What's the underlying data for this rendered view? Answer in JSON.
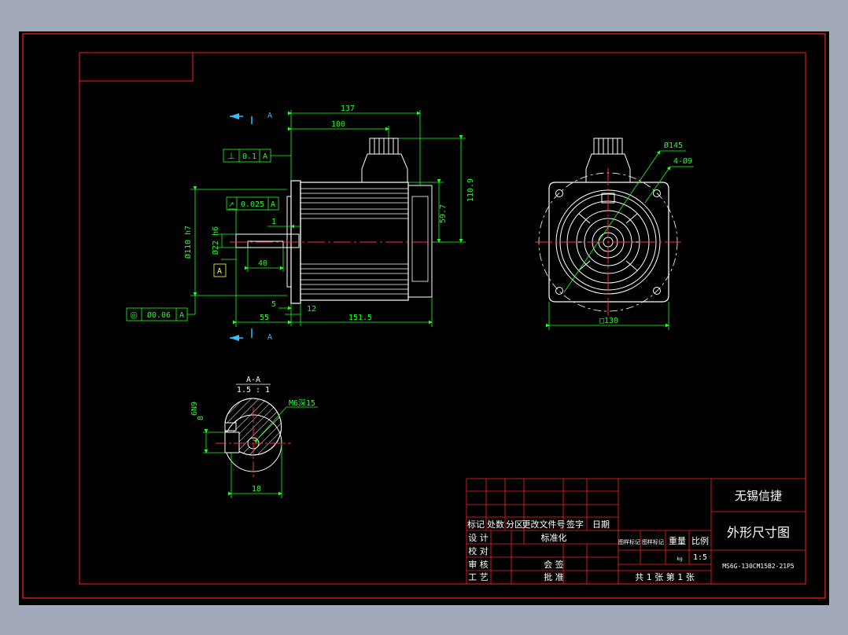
{
  "colors": {
    "background": "#a2a9b8",
    "sheet": "#000000",
    "frame": "#ff2020",
    "green": "#20ff20",
    "white": "#ffffff",
    "yellow": "#ffff60",
    "cyan": "#30c0ff",
    "red": "#ff3030"
  },
  "section_marks": {
    "top": "A",
    "bottom": "A"
  },
  "dims": {
    "d137": "137",
    "d100": "100",
    "d110_9": "110.9",
    "d59_7": "59.7",
    "d1": "1",
    "d110h7": "Ø110 h7",
    "d22h6": "Ø22 h6",
    "d40": "40",
    "d5": "5",
    "d12": "12",
    "d55": "55",
    "d151_5": "151.5",
    "d145": "Ø145",
    "d4_9": "4-Ø9",
    "d130": "□130"
  },
  "tolerances": {
    "perp": {
      "symbol": "⊥",
      "value": "0.1",
      "datum": "A"
    },
    "runout": {
      "symbol": "↗",
      "value": "0.025",
      "datum": "A"
    },
    "concentric": {
      "symbol": "◎",
      "value": "Ø0.06",
      "datum": "A"
    },
    "datum_label": "A"
  },
  "section": {
    "title": "A-A",
    "scale": "1.5 : 1",
    "thread": "M6深15",
    "d6n9": "6N9",
    "d8": "8",
    "d18": "18"
  },
  "title_block": {
    "company": "无锡信捷",
    "drawing_name": "外形尺寸图",
    "drawing_code": "MS6G-130CM15B2-21P5",
    "rev_header": [
      "标记",
      "处数",
      "分区",
      "更改文件号",
      "签字",
      "日期"
    ],
    "design": "设 计",
    "standardize": "标准化",
    "check": "校 对",
    "review": "审 核",
    "countersign": "会 签",
    "process": "工 艺",
    "approve": "批 准",
    "stage_mark": "图样标记",
    "weight": "重量",
    "scale_label": "比例",
    "scale": "1:5",
    "weight_unit": "kg",
    "sheets": "共 1 张 第 1 张"
  }
}
